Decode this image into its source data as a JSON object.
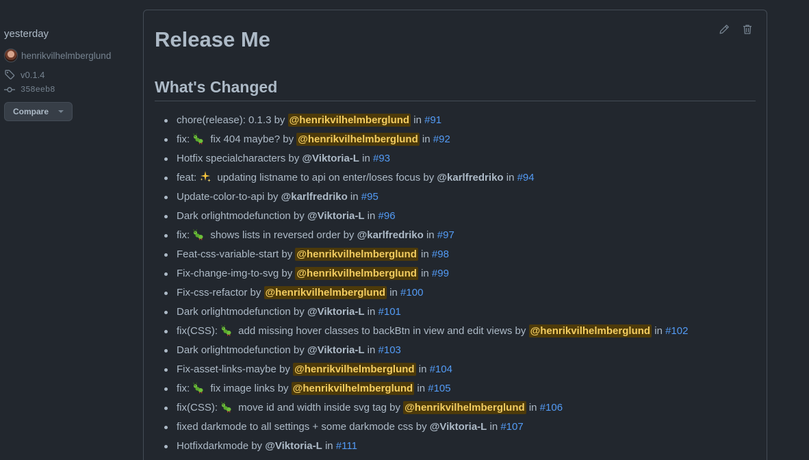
{
  "sidebar": {
    "date": "yesterday",
    "author": "henrikvilhelmberglund",
    "tag": "v0.1.4",
    "commit": "358eeb8",
    "compare_label": "Compare"
  },
  "release": {
    "title": "Release Me",
    "section_title": "What's Changed",
    "items": [
      {
        "pre": "chore(release): 0.1.3",
        "emoji": "",
        "rest": "",
        "by": " by ",
        "author": "@henrikvilhelmberglund",
        "in": " in ",
        "pr": "#91",
        "highlight": true
      },
      {
        "pre": "fix:",
        "emoji": "bug",
        "rest": " fix 404 maybe?",
        "by": " by ",
        "author": "@henrikvilhelmberglund",
        "in": " in ",
        "pr": "#92",
        "highlight": true
      },
      {
        "pre": "Hotfix specialcharacters",
        "emoji": "",
        "rest": "",
        "by": " by ",
        "author": "@Viktoria-L",
        "in": " in ",
        "pr": "#93",
        "highlight": false
      },
      {
        "pre": "feat:",
        "emoji": "sparkles",
        "rest": " updating listname to api on enter/loses focus",
        "by": " by ",
        "author": "@karlfredriko",
        "in": " in ",
        "pr": "#94",
        "highlight": false
      },
      {
        "pre": "Update-color-to-api",
        "emoji": "",
        "rest": "",
        "by": " by ",
        "author": "@karlfredriko",
        "in": " in ",
        "pr": "#95",
        "highlight": false
      },
      {
        "pre": "Dark orlightmodefunction",
        "emoji": "",
        "rest": "",
        "by": " by ",
        "author": "@Viktoria-L",
        "in": " in ",
        "pr": "#96",
        "highlight": false
      },
      {
        "pre": "fix:",
        "emoji": "bug",
        "rest": " shows lists in reversed order",
        "by": " by ",
        "author": "@karlfredriko",
        "in": " in ",
        "pr": "#97",
        "highlight": false
      },
      {
        "pre": "Feat-css-variable-start",
        "emoji": "",
        "rest": "",
        "by": " by ",
        "author": "@henrikvilhelmberglund",
        "in": " in ",
        "pr": "#98",
        "highlight": true
      },
      {
        "pre": "Fix-change-img-to-svg",
        "emoji": "",
        "rest": "",
        "by": " by ",
        "author": "@henrikvilhelmberglund",
        "in": " in ",
        "pr": "#99",
        "highlight": true
      },
      {
        "pre": "Fix-css-refactor",
        "emoji": "",
        "rest": "",
        "by": " by ",
        "author": "@henrikvilhelmberglund",
        "in": " in ",
        "pr": "#100",
        "highlight": true
      },
      {
        "pre": "Dark orlightmodefunction",
        "emoji": "",
        "rest": "",
        "by": " by ",
        "author": "@Viktoria-L",
        "in": " in ",
        "pr": "#101",
        "highlight": false
      },
      {
        "pre": "fix(CSS):",
        "emoji": "bug",
        "rest": " add missing hover classes to backBtn in view and edit views",
        "by": " by ",
        "author": "@henrikvilhelmberglund",
        "in": " in ",
        "pr": "#102",
        "highlight": true
      },
      {
        "pre": "Dark orlightmodefunction",
        "emoji": "",
        "rest": "",
        "by": " by ",
        "author": "@Viktoria-L",
        "in": " in ",
        "pr": "#103",
        "highlight": false
      },
      {
        "pre": "Fix-asset-links-maybe",
        "emoji": "",
        "rest": "",
        "by": " by ",
        "author": "@henrikvilhelmberglund",
        "in": " in ",
        "pr": "#104",
        "highlight": true
      },
      {
        "pre": "fix:",
        "emoji": "bug",
        "rest": " fix image links",
        "by": " by ",
        "author": "@henrikvilhelmberglund",
        "in": " in ",
        "pr": "#105",
        "highlight": true
      },
      {
        "pre": "fix(CSS):",
        "emoji": "bug",
        "rest": " move id and width inside svg tag",
        "by": " by ",
        "author": "@henrikvilhelmberglund",
        "in": " in ",
        "pr": "#106",
        "highlight": true
      },
      {
        "pre": "fixed darkmode to all settings + some darkmode css",
        "emoji": "",
        "rest": "",
        "by": " by ",
        "author": "@Viktoria-L",
        "in": " in ",
        "pr": "#107",
        "highlight": false
      },
      {
        "pre": "Hotfixdarkmode",
        "emoji": "",
        "rest": "",
        "by": " by ",
        "author": "@Viktoria-L",
        "in": " in ",
        "pr": "#111",
        "highlight": false
      }
    ]
  },
  "colors": {
    "background": "#22272e",
    "border": "#444c56",
    "text": "#adbac7",
    "muted": "#768390",
    "link": "#539bf5",
    "mention_highlight_bg": "#4d3a0a",
    "mention_highlight_fg": "#f2cc60"
  },
  "icons": {
    "tag": "tag-icon",
    "commit": "git-commit-icon",
    "edit": "pencil-icon",
    "delete": "trash-icon",
    "bug": "bug-emoji-icon",
    "sparkles": "sparkles-emoji-icon"
  }
}
